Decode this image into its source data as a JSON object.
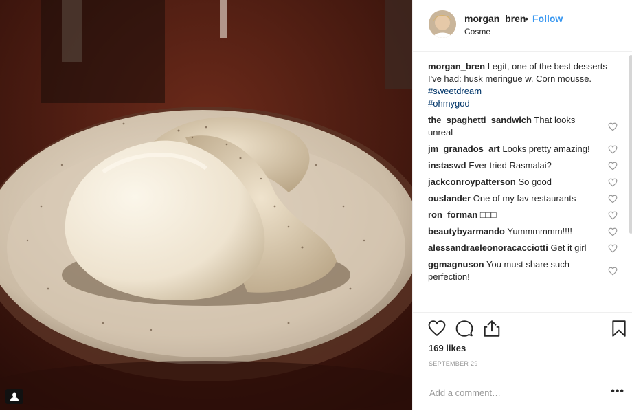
{
  "post": {
    "image_alt": "Husk meringue with corn mousse on a plate",
    "user_tag_icon": "user-tag-icon"
  },
  "header": {
    "username": "morgan_bren",
    "separator": "•",
    "follow_label": "Follow",
    "location": "Cosme"
  },
  "caption": {
    "username": "morgan_bren",
    "text": "Legit, one of the best desserts I've had: husk meringue w. Corn mousse.",
    "hashtags": [
      "#sweetdream",
      "#ohmygod"
    ]
  },
  "comments": [
    {
      "user": "the_spaghetti_sandwich",
      "text": "That looks unreal"
    },
    {
      "user": "jm_granados_art",
      "text": "Looks pretty amazing!"
    },
    {
      "user": "instaswd",
      "text": "Ever tried Rasmalai?"
    },
    {
      "user": "jackconroypatterson",
      "text": "So good"
    },
    {
      "user": "ouslander",
      "text": "One of my fav restaurants"
    },
    {
      "user": "ron_forman",
      "text": "□□□"
    },
    {
      "user": "beautybyarmando",
      "text": "Yummmmmm!!!!"
    },
    {
      "user": "alessandraeleonoracacciotti",
      "text": "Get it girl"
    },
    {
      "user": "ggmagnuson",
      "text": "You must share such perfection!"
    }
  ],
  "actions": {
    "icons": [
      "heart-icon",
      "comment-icon",
      "share-icon",
      "bookmark-icon"
    ]
  },
  "likes": "169 likes",
  "date": "SEPTEMBER 29",
  "add_comment": {
    "placeholder": "Add a comment…",
    "more_label": "•••"
  },
  "colors": {
    "follow": "#3897f0",
    "hashtag": "#003569",
    "muted": "#999999",
    "text": "#262626"
  }
}
